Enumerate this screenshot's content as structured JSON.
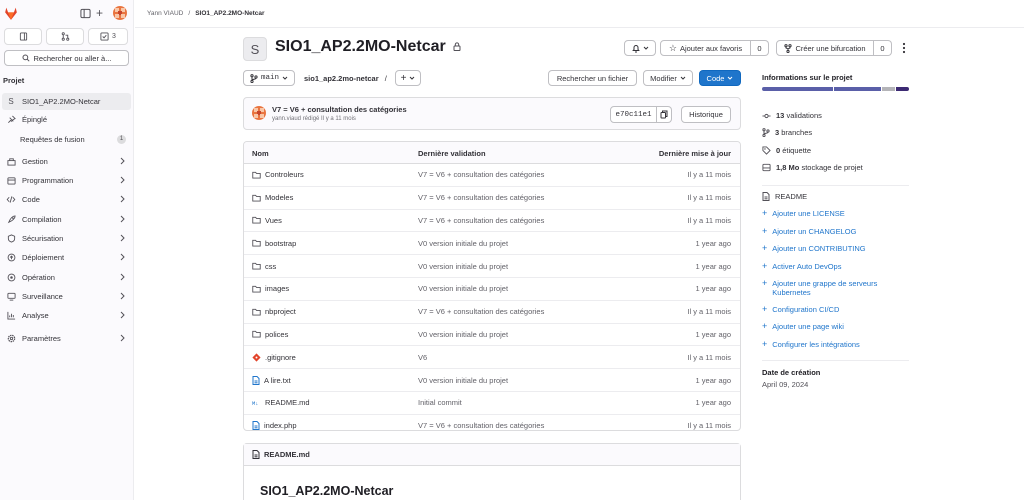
{
  "colors": {
    "accent": "#1f75cb",
    "logo": "#e24329",
    "lang_bar": [
      "#5a5fa8",
      "#5a5fa8",
      "#b4b4b8",
      "#3c2a73"
    ]
  },
  "sidebar": {
    "mr_count": "3",
    "search_label": "Rechercher ou aller à...",
    "section_label": "Projet",
    "project_initial": "S",
    "items": [
      {
        "label": "SIO1_AP2.2MO-Netcar",
        "icon": "project-avatar"
      },
      {
        "label": "Épinglé",
        "icon": "pin-icon"
      },
      {
        "label": "Requêtes de fusion",
        "icon": "",
        "count": "1"
      },
      {
        "label": "Gestion",
        "icon": "users-icon"
      },
      {
        "label": "Programmation",
        "icon": "calendar-icon"
      },
      {
        "label": "Code",
        "icon": "code-icon"
      },
      {
        "label": "Compilation",
        "icon": "rocket-icon"
      },
      {
        "label": "Sécurisation",
        "icon": "shield-icon"
      },
      {
        "label": "Déploiement",
        "icon": "deploy-icon"
      },
      {
        "label": "Opération",
        "icon": "cloud-gear-icon"
      },
      {
        "label": "Surveillance",
        "icon": "monitor-icon"
      },
      {
        "label": "Analyse",
        "icon": "chart-icon"
      },
      {
        "label": "Paramètres",
        "icon": "settings-icon"
      }
    ]
  },
  "breadcrumb": {
    "owner": "Yann VIAUD",
    "separator": "/",
    "project": "SIO1_AP2.2MO-Netcar"
  },
  "project": {
    "initial": "S",
    "title": "SIO1_AP2.2MO-Netcar",
    "star_label": "Ajouter aux favoris",
    "star_count": "0",
    "fork_label": "Créer une bifurcation",
    "fork_count": "0"
  },
  "toolbar": {
    "branch": "main",
    "path": "sio1_ap2.2mo-netcar",
    "path_sep": "/",
    "add": "+",
    "find_file": "Rechercher un fichier",
    "modify": "Modifier",
    "code": "Code"
  },
  "commit": {
    "title": "V7 = V6 + consultation des catégories",
    "meta": "yann.viaud rédigé Il y a 11 mois",
    "sha": "e70c11e1",
    "history": "Historique"
  },
  "table": {
    "headers": {
      "name": "Nom",
      "last_commit": "Dernière validation",
      "last_update": "Dernière mise à jour"
    },
    "rows": [
      {
        "name": "Controleurs",
        "type": "folder",
        "msg": "V7 = V6 + consultation des catégories",
        "date": "Il y a 11 mois"
      },
      {
        "name": "Modeles",
        "type": "folder",
        "msg": "V7 = V6 + consultation des catégories",
        "date": "Il y a 11 mois"
      },
      {
        "name": "Vues",
        "type": "folder",
        "msg": "V7 = V6 + consultation des catégories",
        "date": "Il y a 11 mois"
      },
      {
        "name": "bootstrap",
        "type": "folder",
        "msg": "V0 version initiale du projet",
        "date": "1 year ago"
      },
      {
        "name": "css",
        "type": "folder",
        "msg": "V0 version initiale du projet",
        "date": "1 year ago"
      },
      {
        "name": "images",
        "type": "folder",
        "msg": "V0 version initiale du projet",
        "date": "1 year ago"
      },
      {
        "name": "nbproject",
        "type": "folder",
        "msg": "V7 = V6 + consultation des catégories",
        "date": "Il y a 11 mois"
      },
      {
        "name": "polices",
        "type": "folder",
        "msg": "V0 version initiale du projet",
        "date": "1 year ago"
      },
      {
        "name": ".gitignore",
        "type": "git",
        "msg": "V6",
        "date": "Il y a 11 mois"
      },
      {
        "name": "A lire.txt",
        "type": "file",
        "msg": "V0 version initiale du projet",
        "date": "1 year ago"
      },
      {
        "name": "README.md",
        "type": "md",
        "msg": "Initial commit",
        "date": "1 year ago"
      },
      {
        "name": "index.php",
        "type": "file",
        "msg": "V7 = V6 + consultation des catégories",
        "date": "Il y a 11 mois"
      }
    ]
  },
  "readme": {
    "header": "README.md",
    "title": "SIO1_AP2.2MO-Netcar"
  },
  "info": {
    "title": "Informations sur le projet",
    "lang_shares": [
      0.49,
      0.33,
      0.09,
      0.09
    ],
    "stats": [
      {
        "num": "13",
        "text": "validations",
        "icon": "commit-icon"
      },
      {
        "num": "3",
        "text": "branches",
        "icon": "branch-icon"
      },
      {
        "num": "0",
        "text": "étiquette",
        "icon": "tag-icon"
      },
      {
        "num": "1,8 Mo",
        "text": "stockage de projet",
        "icon": "storage-icon"
      }
    ],
    "readme": "README",
    "links": [
      "Ajouter une LICENSE",
      "Ajouter un CHANGELOG",
      "Ajouter un CONTRIBUTING",
      "Activer Auto DevOps",
      "Ajouter une grappe de serveurs Kubernetes",
      "Configuration CI/CD",
      "Ajouter une page wiki",
      "Configurer les intégrations"
    ],
    "created_label": "Date de création",
    "created_date": "April 09, 2024"
  }
}
